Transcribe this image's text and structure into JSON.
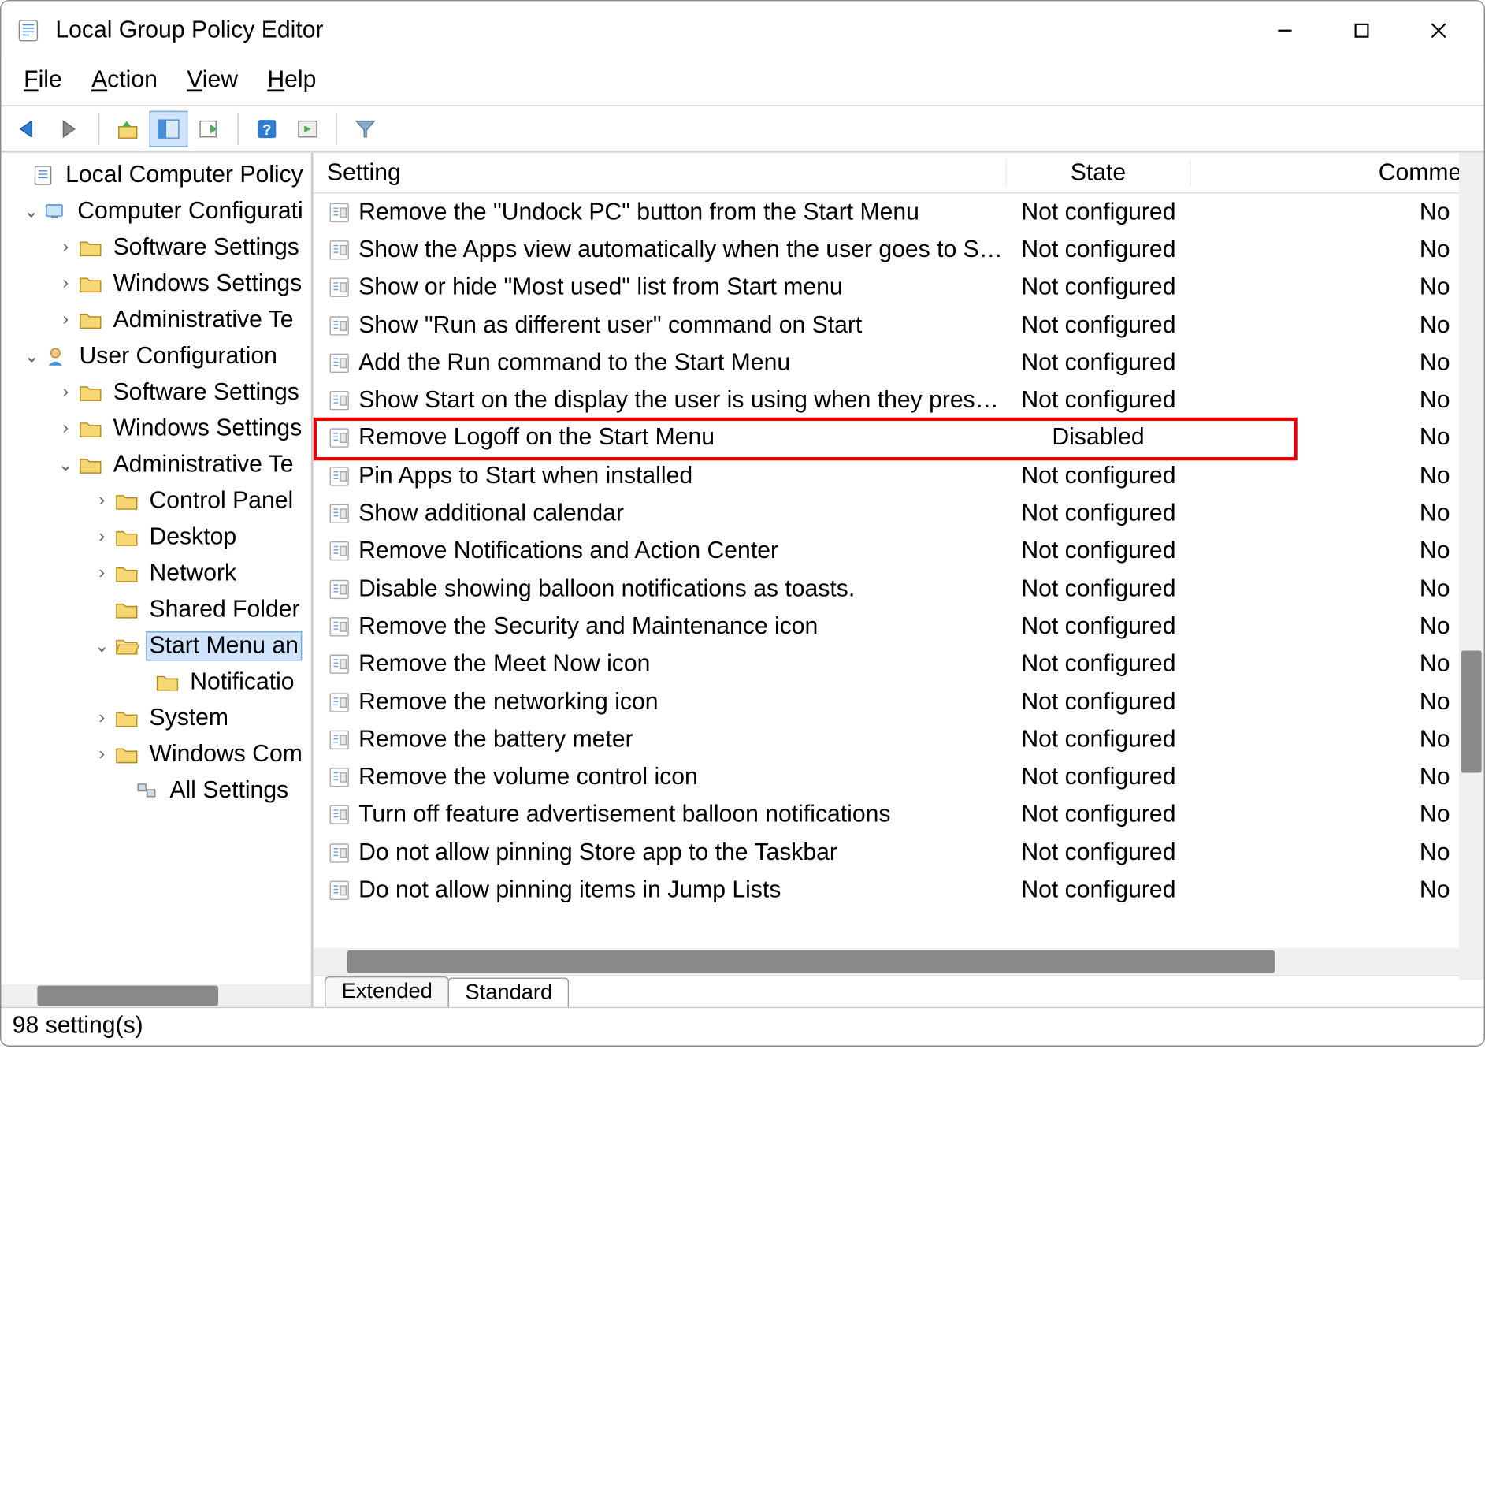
{
  "titlebar": {
    "title": "Local Group Policy Editor"
  },
  "menubar": {
    "file": "File",
    "action": "Action",
    "view": "View",
    "help": "Help"
  },
  "tree": {
    "root": "Local Computer Policy",
    "cc": "Computer Configurati",
    "cc_soft": "Software Settings",
    "cc_win": "Windows Settings",
    "cc_adm": "Administrative Te",
    "uc": "User Configuration",
    "uc_soft": "Software Settings",
    "uc_win": "Windows Settings",
    "uc_adm": "Administrative Te",
    "cp": "Control Panel",
    "desktop": "Desktop",
    "network": "Network",
    "shared": "Shared Folder",
    "start": "Start Menu an",
    "notif": "Notificatio",
    "system": "System",
    "wincom": "Windows Com",
    "allset": "All Settings"
  },
  "columns": {
    "setting": "Setting",
    "state": "State",
    "comment": "Commen"
  },
  "settings": [
    {
      "name": "Remove the \"Undock PC\" button from the Start Menu",
      "state": "Not configured",
      "comment": "No"
    },
    {
      "name": "Show the Apps view automatically when the user goes to Start",
      "state": "Not configured",
      "comment": "No"
    },
    {
      "name": "Show or hide \"Most used\" list from Start menu",
      "state": "Not configured",
      "comment": "No"
    },
    {
      "name": "Show \"Run as different user\" command on Start",
      "state": "Not configured",
      "comment": "No"
    },
    {
      "name": "Add the Run command to the Start Menu",
      "state": "Not configured",
      "comment": "No"
    },
    {
      "name": "Show Start on the display the user is using when they press the ...",
      "state": "Not configured",
      "comment": "No"
    },
    {
      "name": "Remove Logoff on the Start Menu",
      "state": "Disabled",
      "comment": "No",
      "highlighted": true,
      "state_center": true
    },
    {
      "name": "Pin Apps to Start when installed",
      "state": "Not configured",
      "comment": "No"
    },
    {
      "name": "Show additional calendar",
      "state": "Not configured",
      "comment": "No"
    },
    {
      "name": "Remove Notifications and Action Center",
      "state": "Not configured",
      "comment": "No"
    },
    {
      "name": "Disable showing balloon notifications as toasts.",
      "state": "Not configured",
      "comment": "No"
    },
    {
      "name": "Remove the Security and Maintenance icon",
      "state": "Not configured",
      "comment": "No"
    },
    {
      "name": "Remove the Meet Now icon",
      "state": "Not configured",
      "comment": "No"
    },
    {
      "name": "Remove the networking icon",
      "state": "Not configured",
      "comment": "No"
    },
    {
      "name": "Remove the battery meter",
      "state": "Not configured",
      "comment": "No"
    },
    {
      "name": "Remove the volume control icon",
      "state": "Not configured",
      "comment": "No"
    },
    {
      "name": "Turn off feature advertisement balloon notifications",
      "state": "Not configured",
      "comment": "No"
    },
    {
      "name": "Do not allow pinning Store app to the Taskbar",
      "state": "Not configured",
      "comment": "No"
    },
    {
      "name": "Do not allow pinning items in Jump Lists",
      "state": "Not configured",
      "comment": "No"
    }
  ],
  "tabs": {
    "extended": "Extended",
    "standard": "Standard"
  },
  "status": "98 setting(s)"
}
